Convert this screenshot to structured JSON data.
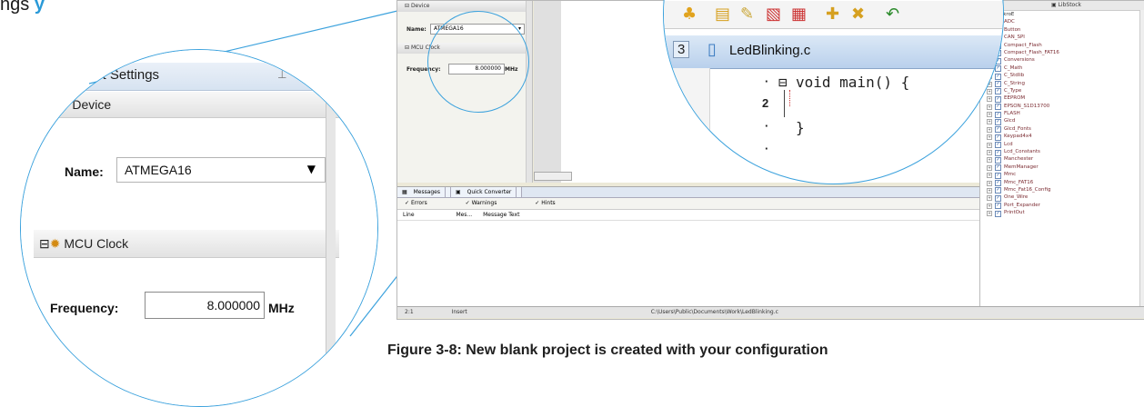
{
  "caption_top": {
    "pre": "ngs",
    "highlight": "y"
  },
  "figure_caption": "Figure 3-8: New blank project is created with your configuration",
  "zoom_left": {
    "panel_title": "oject Settings",
    "device_section": "Device",
    "name_label": "Name:",
    "name_value": "ATMEGA16",
    "clock_section": "MCU Clock",
    "frequency_label": "Frequency:",
    "frequency_value": "8.000000",
    "frequency_unit": "MHz"
  },
  "zoom_right": {
    "tab_number": "3",
    "file_tab": "LedBlinking.c",
    "code_lines": [
      "void main() {",
      "",
      "}"
    ],
    "line_numbers": [
      "2"
    ]
  },
  "ide": {
    "device_section": "Device",
    "name_label": "Name:",
    "name_value": "ATMEGA16",
    "clock_section": "MCU Clock",
    "frequency_label": "Frequency:",
    "frequency_value": "8.000000",
    "frequency_unit": "MHz",
    "msg_tabs": [
      "Messages",
      "Quick Converter"
    ],
    "filters": [
      "Errors",
      "Warnings",
      "Hints"
    ],
    "columns": [
      "Line",
      "Mes...",
      "Message Text"
    ],
    "status": {
      "pos": "2:1",
      "mode": "Insert",
      "path": "C:\\Users\\Public\\Documents\\Work\\LedBlinking.c"
    },
    "libstock": "LibStock",
    "tree_root": "mikroE",
    "libraries": [
      "ADC",
      "Button",
      "CAN_SPI",
      "Compact_Flash",
      "Compact_Flash_FAT16",
      "Conversions",
      "C_Math",
      "C_Stdlib",
      "C_String",
      "C_Type",
      "EEPROM",
      "EPSON_S1D13700",
      "FLASH",
      "Glcd",
      "Glcd_Fonts",
      "Keypad4x4",
      "Lcd",
      "Lcd_Constants",
      "Manchester",
      "MemManager",
      "Mmc",
      "Mmc_FAT16",
      "Mmc_Fat16_Config",
      "One_Wire",
      "Port_Expander",
      "PrintOut"
    ]
  },
  "colors": {
    "accent_blue": "#3ca2dd",
    "highlight": "#2a9ad8"
  }
}
